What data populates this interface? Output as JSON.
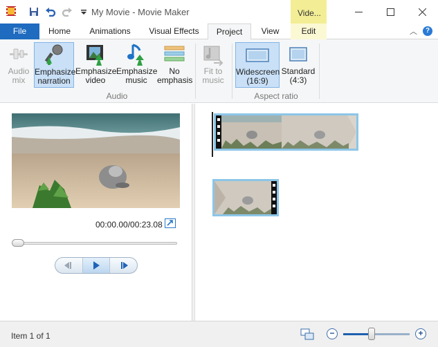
{
  "window": {
    "title": "My Movie - Movie Maker",
    "contextual_tab_group": "Vide..."
  },
  "tabs": [
    {
      "label": "File"
    },
    {
      "label": "Home"
    },
    {
      "label": "Animations"
    },
    {
      "label": "Visual Effects"
    },
    {
      "label": "Project"
    },
    {
      "label": "View"
    },
    {
      "label": "Edit"
    }
  ],
  "ribbon": {
    "audio_group_label": "Audio",
    "aspect_group_label": "Aspect ratio",
    "buttons": [
      {
        "line1": "Audio",
        "line2": "mix",
        "icon": "audio-mix-icon",
        "state": "disabled"
      },
      {
        "line1": "Emphasize",
        "line2": "narration",
        "icon": "microphone-icon",
        "state": "selected"
      },
      {
        "line1": "Emphasize",
        "line2": "video",
        "icon": "film-icon",
        "state": "normal"
      },
      {
        "line1": "Emphasize",
        "line2": "music",
        "icon": "music-note-icon",
        "state": "normal"
      },
      {
        "line1": "No",
        "line2": "emphasis",
        "icon": "no-emphasis-icon",
        "state": "normal"
      },
      {
        "line1": "Fit to",
        "line2": "music",
        "icon": "fit-to-music-icon",
        "state": "disabled"
      },
      {
        "line1": "Widescreen",
        "line2": "(16:9)",
        "icon": "widescreen-icon",
        "state": "selected"
      },
      {
        "line1": "Standard",
        "line2": "(4:3)",
        "icon": "standard-icon",
        "state": "normal"
      }
    ]
  },
  "preview": {
    "timecode": "00:00.00/00:23.08"
  },
  "status": {
    "text": "Item 1 of 1"
  },
  "colors": {
    "file_tab": "#1e6bbf",
    "contextual_highlight": "#f3ee95",
    "selected_button": "#c9e0f7",
    "clip_border": "#8cc6e8"
  }
}
